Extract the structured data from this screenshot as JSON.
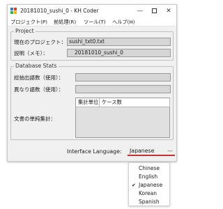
{
  "window": {
    "title": "20181010_sushi_0 - KH Coder",
    "minimize_glyph": "—",
    "close_glyph": "✕"
  },
  "menu": {
    "items": [
      "プロジェクト(P)",
      "前処理(R)",
      "ツール(T)",
      "ヘルプ(H)"
    ]
  },
  "project": {
    "group_title": "Project",
    "current_label": "現在のプロジェクト：",
    "current_value": "sushi_txt0.txt",
    "memo_label": "説明（メモ）：",
    "memo_value": "20181010_sushi_0"
  },
  "stats": {
    "group_title": "Database Stats",
    "total_words_label": "総抽出語数（使用）：",
    "distinct_words_label": "異なり語数（使用）：",
    "units_label": "文書の単純集計：",
    "table_headers": [
      "集計単位",
      "ケース数"
    ]
  },
  "language": {
    "label": "Interface Language:",
    "selected": "Japanese",
    "options": [
      "Chinese",
      "English",
      "Japanese",
      "Korean",
      "Spanish"
    ],
    "checked_index": 2,
    "check_glyph": "✔",
    "arrow_glyph": "—",
    "underline_color": "#c43030"
  },
  "colors": {
    "icon_squares": [
      "#2b7bd6",
      "#d63b2b",
      "#2bb24c",
      "#e6b800"
    ]
  }
}
